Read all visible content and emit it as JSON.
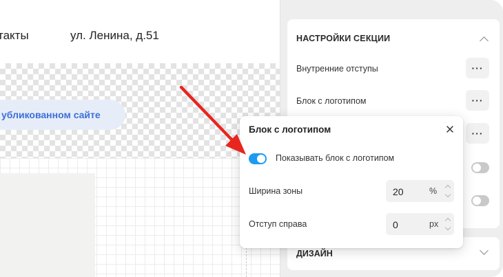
{
  "canvas": {
    "nav_link": "такты",
    "address": "ул. Ленина, д.51",
    "publish_pill": "убликованном сайте"
  },
  "panel": {
    "section_title": "НАСТРОЙКИ СЕКЦИИ",
    "rows": [
      {
        "label": "Внутренние отступы",
        "control": "dots"
      },
      {
        "label": "Блок с логотипом",
        "control": "dots"
      }
    ],
    "dots_label": "···",
    "design_title": "ДИЗАЙН"
  },
  "popover": {
    "title": "Блок с логотипом",
    "toggle_label": "Показывать блок с логотипом",
    "toggle_on": true,
    "fields": [
      {
        "label": "Ширина зоны",
        "value": "20",
        "unit": "%"
      },
      {
        "label": "Отступ справа",
        "value": "0",
        "unit": "px"
      }
    ]
  },
  "colors": {
    "accent_toggle": "#1e9bf0",
    "annotation_arrow": "#e8251f",
    "publish_text": "#3b6fd8"
  }
}
